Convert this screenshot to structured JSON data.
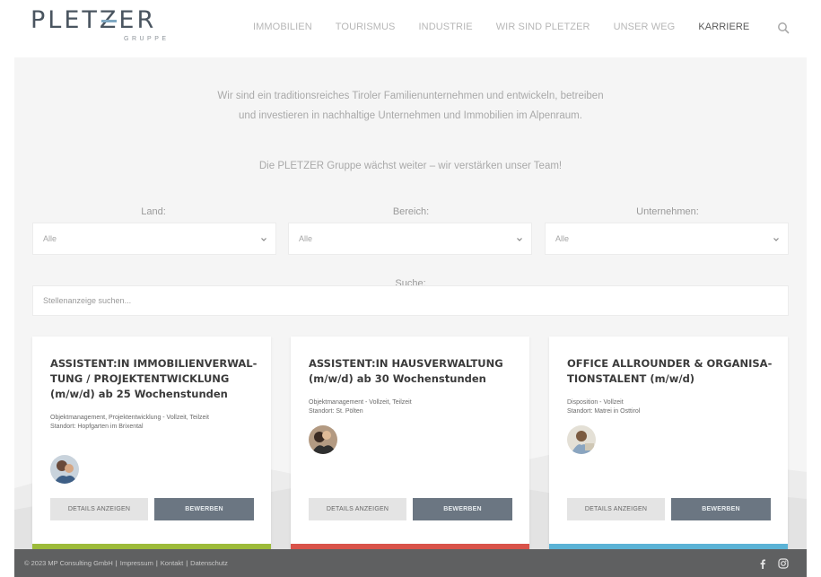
{
  "header": {
    "logo_main": "PLETZER",
    "logo_sub": "GRUPPE",
    "nav": [
      "IMMOBILIEN",
      "TOURISMUS",
      "INDUSTRIE",
      "WIR SIND PLETZER",
      "UNSER WEG",
      "KARRIERE"
    ],
    "active_nav": "KARRIERE"
  },
  "intro": {
    "text": "Wir sind ein traditionsreiches Tiroler Familienunternehmen und entwickeln, betreiben und investieren in nachhaltige Unternehmen und Immobilien im Alpenraum.",
    "tagline": "Die PLETZER Gruppe wächst weiter – wir verstärken unser Team!"
  },
  "filters": {
    "land_label": "Land:",
    "land_value": "Alle",
    "bereich_label": "Bereich:",
    "bereich_value": "Alle",
    "unternehmen_label": "Unternehmen:",
    "unternehmen_value": "Alle",
    "search_label": "Suche:",
    "search_placeholder": "Stellenanzeige suchen..."
  },
  "jobs": [
    {
      "title": "ASSISTENT:IN IMMOBILIENVERWAL-TUNG / PROJEKTENTWICKLUNG (m/w/d) ab 25 Wochenstunden",
      "category": "Objektmanagement, Projektentwicklung - Vollzeit, Teilzeit",
      "location": "Standort: Hopfgarten im Brixental",
      "details_label": "DETAILS ANZEIGEN",
      "apply_label": "BEWERBEN",
      "bar_color": "#9dbb3a"
    },
    {
      "title": "ASSISTENT:IN HAUSVERWALTUNG (m/w/d) ab 30 Wochenstunden",
      "category": "Objektmanagement - Vollzeit, Teilzeit",
      "location": "Standort: St. Pölten",
      "details_label": "DETAILS ANZEIGEN",
      "apply_label": "BEWERBEN",
      "bar_color": "#d9534a"
    },
    {
      "title": "OFFICE ALLROUNDER & ORGANISA-TIONSTALENT (m/w/d)",
      "category": "Disposition - Vollzeit",
      "location": "Standort: Matrei in Osttirol",
      "details_label": "DETAILS ANZEIGEN",
      "apply_label": "BEWERBEN",
      "bar_color": "#5bb3d6"
    }
  ],
  "footer": {
    "copyright": "© 2023 MP Consulting GmbH",
    "impressum": "Impressum",
    "kontakt": "Kontakt",
    "datenschutz": "Datenschutz",
    "separator": "|"
  },
  "colors": {
    "accent_logo": "#7fa8c2",
    "button_primary": "#6b7682",
    "footer_bg": "#5f6061"
  },
  "icons": [
    "search-icon",
    "chevron-down-icon",
    "facebook-icon",
    "instagram-icon"
  ]
}
